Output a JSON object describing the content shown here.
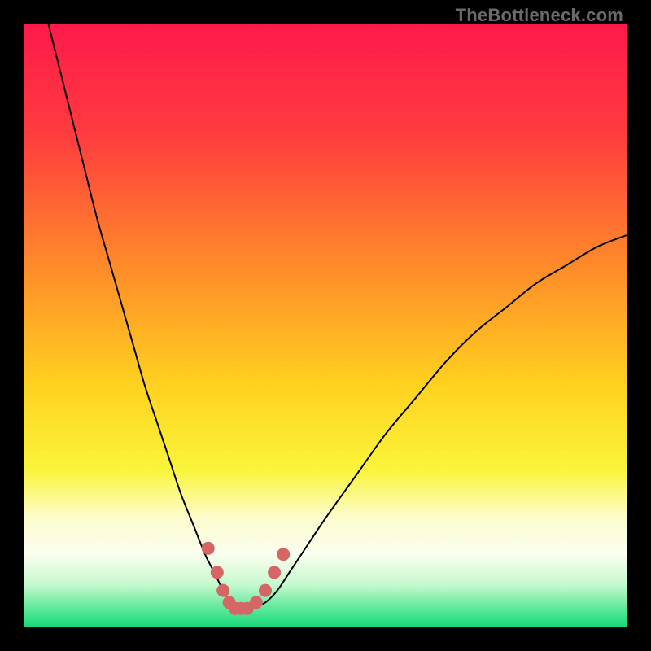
{
  "watermark": "TheBottleneck.com",
  "chart_data": {
    "type": "line",
    "title": "",
    "xlabel": "",
    "ylabel": "",
    "xlim": [
      0,
      100
    ],
    "ylim": [
      0,
      100
    ],
    "grid": false,
    "legend": false,
    "annotations": [],
    "gradient_stops": [
      {
        "offset": 0.0,
        "color": "#ff1a4b"
      },
      {
        "offset": 0.18,
        "color": "#ff3b3f"
      },
      {
        "offset": 0.4,
        "color": "#ff8a2a"
      },
      {
        "offset": 0.6,
        "color": "#ffd21f"
      },
      {
        "offset": 0.74,
        "color": "#faf53a"
      },
      {
        "offset": 0.82,
        "color": "#fdfccf"
      },
      {
        "offset": 0.88,
        "color": "#fafeee"
      },
      {
        "offset": 0.93,
        "color": "#c6f9cf"
      },
      {
        "offset": 0.97,
        "color": "#5de89a"
      },
      {
        "offset": 1.0,
        "color": "#17d97a"
      }
    ],
    "series": [
      {
        "name": "bottleneck-curve",
        "color": "#000000",
        "width": 2,
        "x": [
          4,
          6,
          8,
          10,
          12,
          14,
          16,
          18,
          20,
          22,
          24,
          26,
          28,
          30,
          31,
          32,
          33,
          34,
          35,
          36,
          37,
          38,
          40,
          42,
          44,
          46,
          50,
          55,
          60,
          65,
          70,
          75,
          80,
          85,
          90,
          95,
          100
        ],
        "y": [
          100,
          92,
          84,
          76,
          68,
          61,
          54,
          47,
          40,
          34,
          28,
          22,
          17,
          12,
          10,
          8,
          6,
          4.5,
          3.5,
          3,
          3,
          3.2,
          4,
          6,
          9,
          12,
          18,
          25,
          32,
          38,
          44,
          49,
          53,
          57,
          60,
          63,
          65
        ]
      }
    ],
    "markers": {
      "name": "highlight-markers",
      "color": "#d66666",
      "radius": 8,
      "points": [
        {
          "x": 30.5,
          "y": 13
        },
        {
          "x": 32.0,
          "y": 9
        },
        {
          "x": 33.0,
          "y": 6
        },
        {
          "x": 34.0,
          "y": 4
        },
        {
          "x": 35.0,
          "y": 3
        },
        {
          "x": 36.0,
          "y": 3
        },
        {
          "x": 37.0,
          "y": 3
        },
        {
          "x": 38.5,
          "y": 4
        },
        {
          "x": 40.0,
          "y": 6
        },
        {
          "x": 41.5,
          "y": 9
        },
        {
          "x": 43.0,
          "y": 12
        }
      ]
    }
  }
}
